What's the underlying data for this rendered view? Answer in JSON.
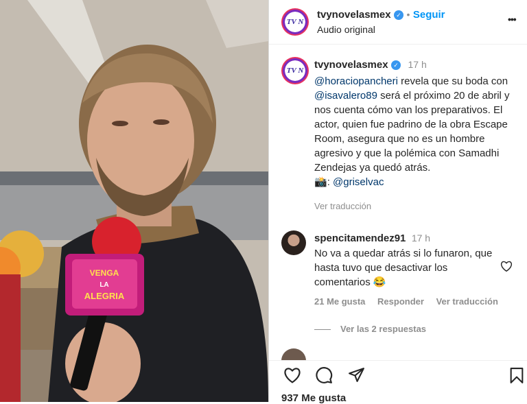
{
  "post": {
    "username": "tvynovelasmex",
    "follow_label": "Seguir",
    "audio_label": "Audio original",
    "avatar_text": "TV N",
    "more_label": "•••"
  },
  "caption": {
    "username": "tvynovelasmex",
    "time": "17 h",
    "mention1": "@horaciopancheri",
    "text1": " revela que su boda con ",
    "mention2": "@isavalero89",
    "text2": " será el próximo 20 de abril y nos cuenta cómo van los preparativos. El actor, quien fue padrino de la obra Escape Room, asegura que no es un hombre agresivo y que la polémica con Samadhi Zendejas ya quedó atrás.",
    "camera_emoji": "📸",
    "credit_mention": "@griselvac",
    "translate": "Ver traducción"
  },
  "comment": {
    "username": "spencitamendez91",
    "time": "17 h",
    "text": "No va a quedar atrás si lo funaron, que hasta tuvo que desactivar los comentarios 😂",
    "likes": "21 Me gusta",
    "reply": "Responder",
    "translate": "Ver traducción",
    "view_replies": "Ver las 2 respuestas"
  },
  "footer": {
    "likes": "937 Me gusta"
  },
  "media": {
    "mic_text_1": "VENGA",
    "mic_text_2": "LA",
    "mic_text_3": "ALEGRIA"
  },
  "colors": {
    "accent": "#0095f6",
    "mention": "#00376b",
    "verified": "#3897f0",
    "muted": "#8e8e8e"
  }
}
